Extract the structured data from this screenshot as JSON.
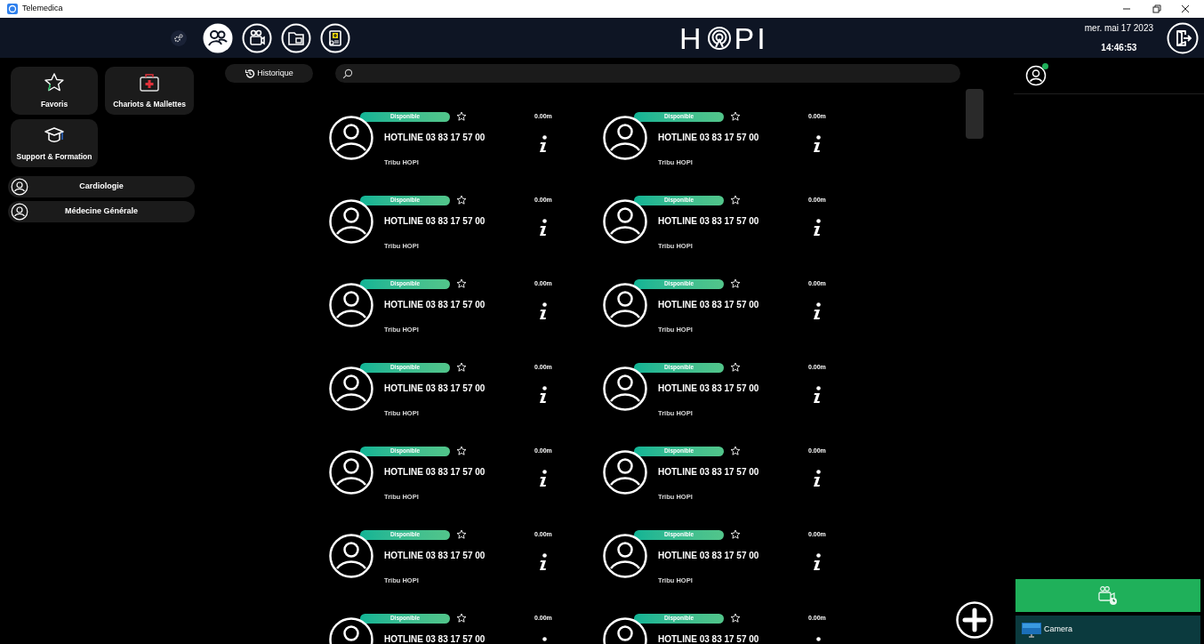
{
  "window": {
    "title": "Telemedica"
  },
  "header": {
    "nav": [
      {
        "kind": "contacts",
        "selected": true
      },
      {
        "kind": "video",
        "selected": false
      },
      {
        "kind": "folder",
        "selected": false
      },
      {
        "kind": "clipboard",
        "selected": false
      }
    ],
    "logo": {
      "before": "H",
      "after": "PI"
    },
    "date": "mer. mai 17 2023",
    "time": "14:46:53"
  },
  "sidebar": {
    "tiles": [
      {
        "kind": "star",
        "label": "Favoris"
      },
      {
        "kind": "case",
        "label": "Chariots & Mallettes"
      },
      {
        "kind": "cap",
        "label": "Support & Formation"
      }
    ],
    "groups": [
      {
        "label": "Cardiologie"
      },
      {
        "label": "Médecine Générale"
      }
    ]
  },
  "history_button": "Historique",
  "contacts": [
    {
      "status": "Disponible",
      "favorite": false,
      "distance": "0.00m",
      "name": "HOTLINE 03 83 17 57 00",
      "group": "Tribu HOPI"
    },
    {
      "status": "Disponible",
      "favorite": false,
      "distance": "0.00m",
      "name": "HOTLINE 03 83 17 57 00",
      "group": "Tribu HOPI"
    },
    {
      "status": "Disponible",
      "favorite": false,
      "distance": "0.00m",
      "name": "HOTLINE 03 83 17 57 00",
      "group": "Tribu HOPI"
    },
    {
      "status": "Disponible",
      "favorite": false,
      "distance": "0.00m",
      "name": "HOTLINE 03 83 17 57 00",
      "group": "Tribu HOPI"
    },
    {
      "status": "Disponible",
      "favorite": false,
      "distance": "0.00m",
      "name": "HOTLINE 03 83 17 57 00",
      "group": "Tribu HOPI"
    },
    {
      "status": "Disponible",
      "favorite": false,
      "distance": "0.00m",
      "name": "HOTLINE 03 83 17 57 00",
      "group": "Tribu HOPI"
    },
    {
      "status": "Disponible",
      "favorite": false,
      "distance": "0.00m",
      "name": "HOTLINE 03 83 17 57 00",
      "group": "Tribu HOPI"
    },
    {
      "status": "Disponible",
      "favorite": false,
      "distance": "0.00m",
      "name": "HOTLINE 03 83 17 57 00",
      "group": "Tribu HOPI"
    },
    {
      "status": "Disponible",
      "favorite": false,
      "distance": "0.00m",
      "name": "HOTLINE 03 83 17 57 00",
      "group": "Tribu HOPI"
    },
    {
      "status": "Disponible",
      "favorite": false,
      "distance": "0.00m",
      "name": "HOTLINE 03 83 17 57 00",
      "group": "Tribu HOPI"
    },
    {
      "status": "Disponible",
      "favorite": false,
      "distance": "0.00m",
      "name": "HOTLINE 03 83 17 57 00",
      "group": "Tribu HOPI"
    },
    {
      "status": "Disponible",
      "favorite": false,
      "distance": "0.00m",
      "name": "HOTLINE 03 83 17 57 00",
      "group": "Tribu HOPI"
    },
    {
      "status": "Disponible",
      "favorite": false,
      "distance": "0.00m",
      "name": "HOTLINE 03 83 17 57 00"
    },
    {
      "status": "Disponible",
      "favorite": false,
      "distance": "0.00m",
      "name": "HOTLINE 03 83 17 57 00"
    }
  ],
  "right_panel": {
    "user_online": true,
    "devices": [
      {
        "label": "Camera"
      }
    ]
  }
}
